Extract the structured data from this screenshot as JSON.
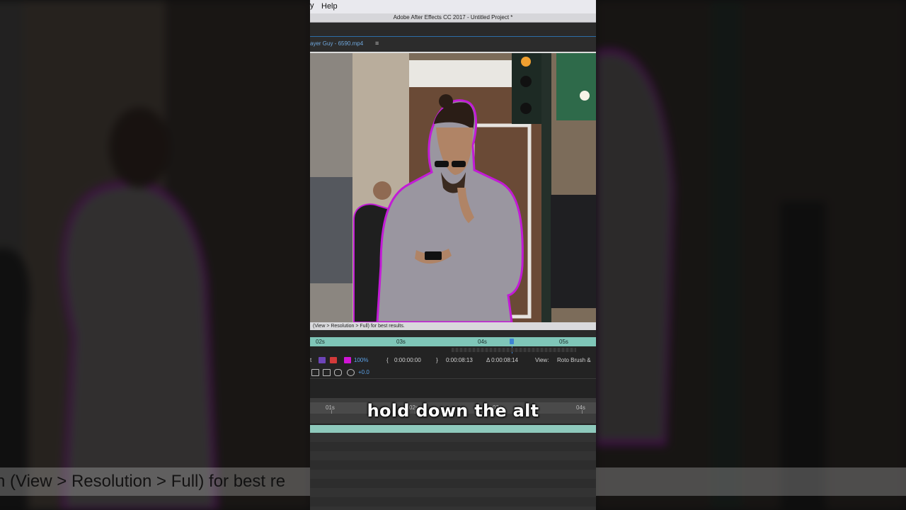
{
  "menubar": {
    "help_label": "Help",
    "edge_glyph": "y"
  },
  "window": {
    "title": "Adobe After Effects CC 2017 - Untitled Project *"
  },
  "layer_panel": {
    "tab_label": "ayer Guy - 6590.mp4",
    "tab_menu_icon": "hamburger-menu-icon"
  },
  "status": {
    "message": "(View > Resolution > Full) for best results."
  },
  "timeline_ruler": {
    "ticks": [
      "02s",
      "03s",
      "04s",
      "05s"
    ]
  },
  "controls": {
    "zoom": "100",
    "zoom_unit": "%",
    "in_time": "0:00:00:00",
    "out_time": "0:00:08:13",
    "duration": "Δ 0:00:08:14",
    "view_label": "View:",
    "view_value": "Roto Brush & "
  },
  "controls2": {
    "exposure": "+0.0"
  },
  "comp_ruler": {
    "ticks": [
      "01s",
      "02s",
      "03s",
      "04s"
    ]
  },
  "caption": "hold down the alt",
  "background_status": "n (View > Resolution > Full) for best re",
  "colors": {
    "accent_blue": "#3d84d4",
    "timeline_teal": "#7fc6b8",
    "roto_outline": "#c21bd6"
  }
}
